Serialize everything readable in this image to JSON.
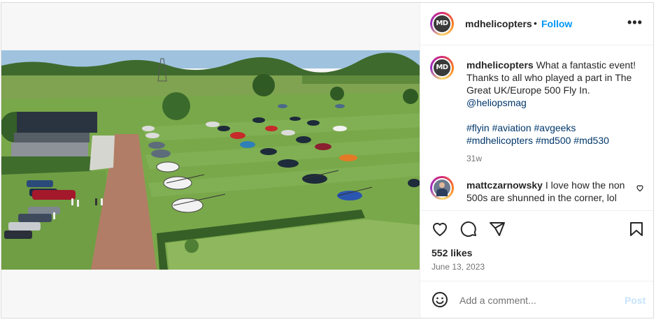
{
  "post": {
    "username": "mdhelicopters",
    "avatar_text": "MD",
    "follow_label": "Follow",
    "separator": "•",
    "more_icon": "more-horizontal-icon"
  },
  "caption": {
    "username": "mdhelicopters",
    "text": "What a fantastic event! Thanks to all who played a part in The Great UK/Europe 500 Fly In.",
    "mention": "@heliopsmag",
    "hashtags": "#flyin #aviation #avgeeks #mdhelicopters #md500 #md530",
    "age": "31w"
  },
  "comment": {
    "username": "mattczarnowsky",
    "text": "I love how the non 500s are shunned in the corner, lol"
  },
  "actions": {
    "like_icon": "heart-icon",
    "comment_icon": "comment-icon",
    "share_icon": "share-icon",
    "save_icon": "bookmark-icon"
  },
  "likes": "552 likes",
  "date": "June 13, 2023",
  "add_comment": {
    "placeholder": "Add a comment...",
    "post_label": "Post",
    "emoji_icon": "emoji-icon"
  },
  "colors": {
    "follow": "#0095f6",
    "link": "#00376b",
    "post_disabled": "#c7e3fb"
  }
}
